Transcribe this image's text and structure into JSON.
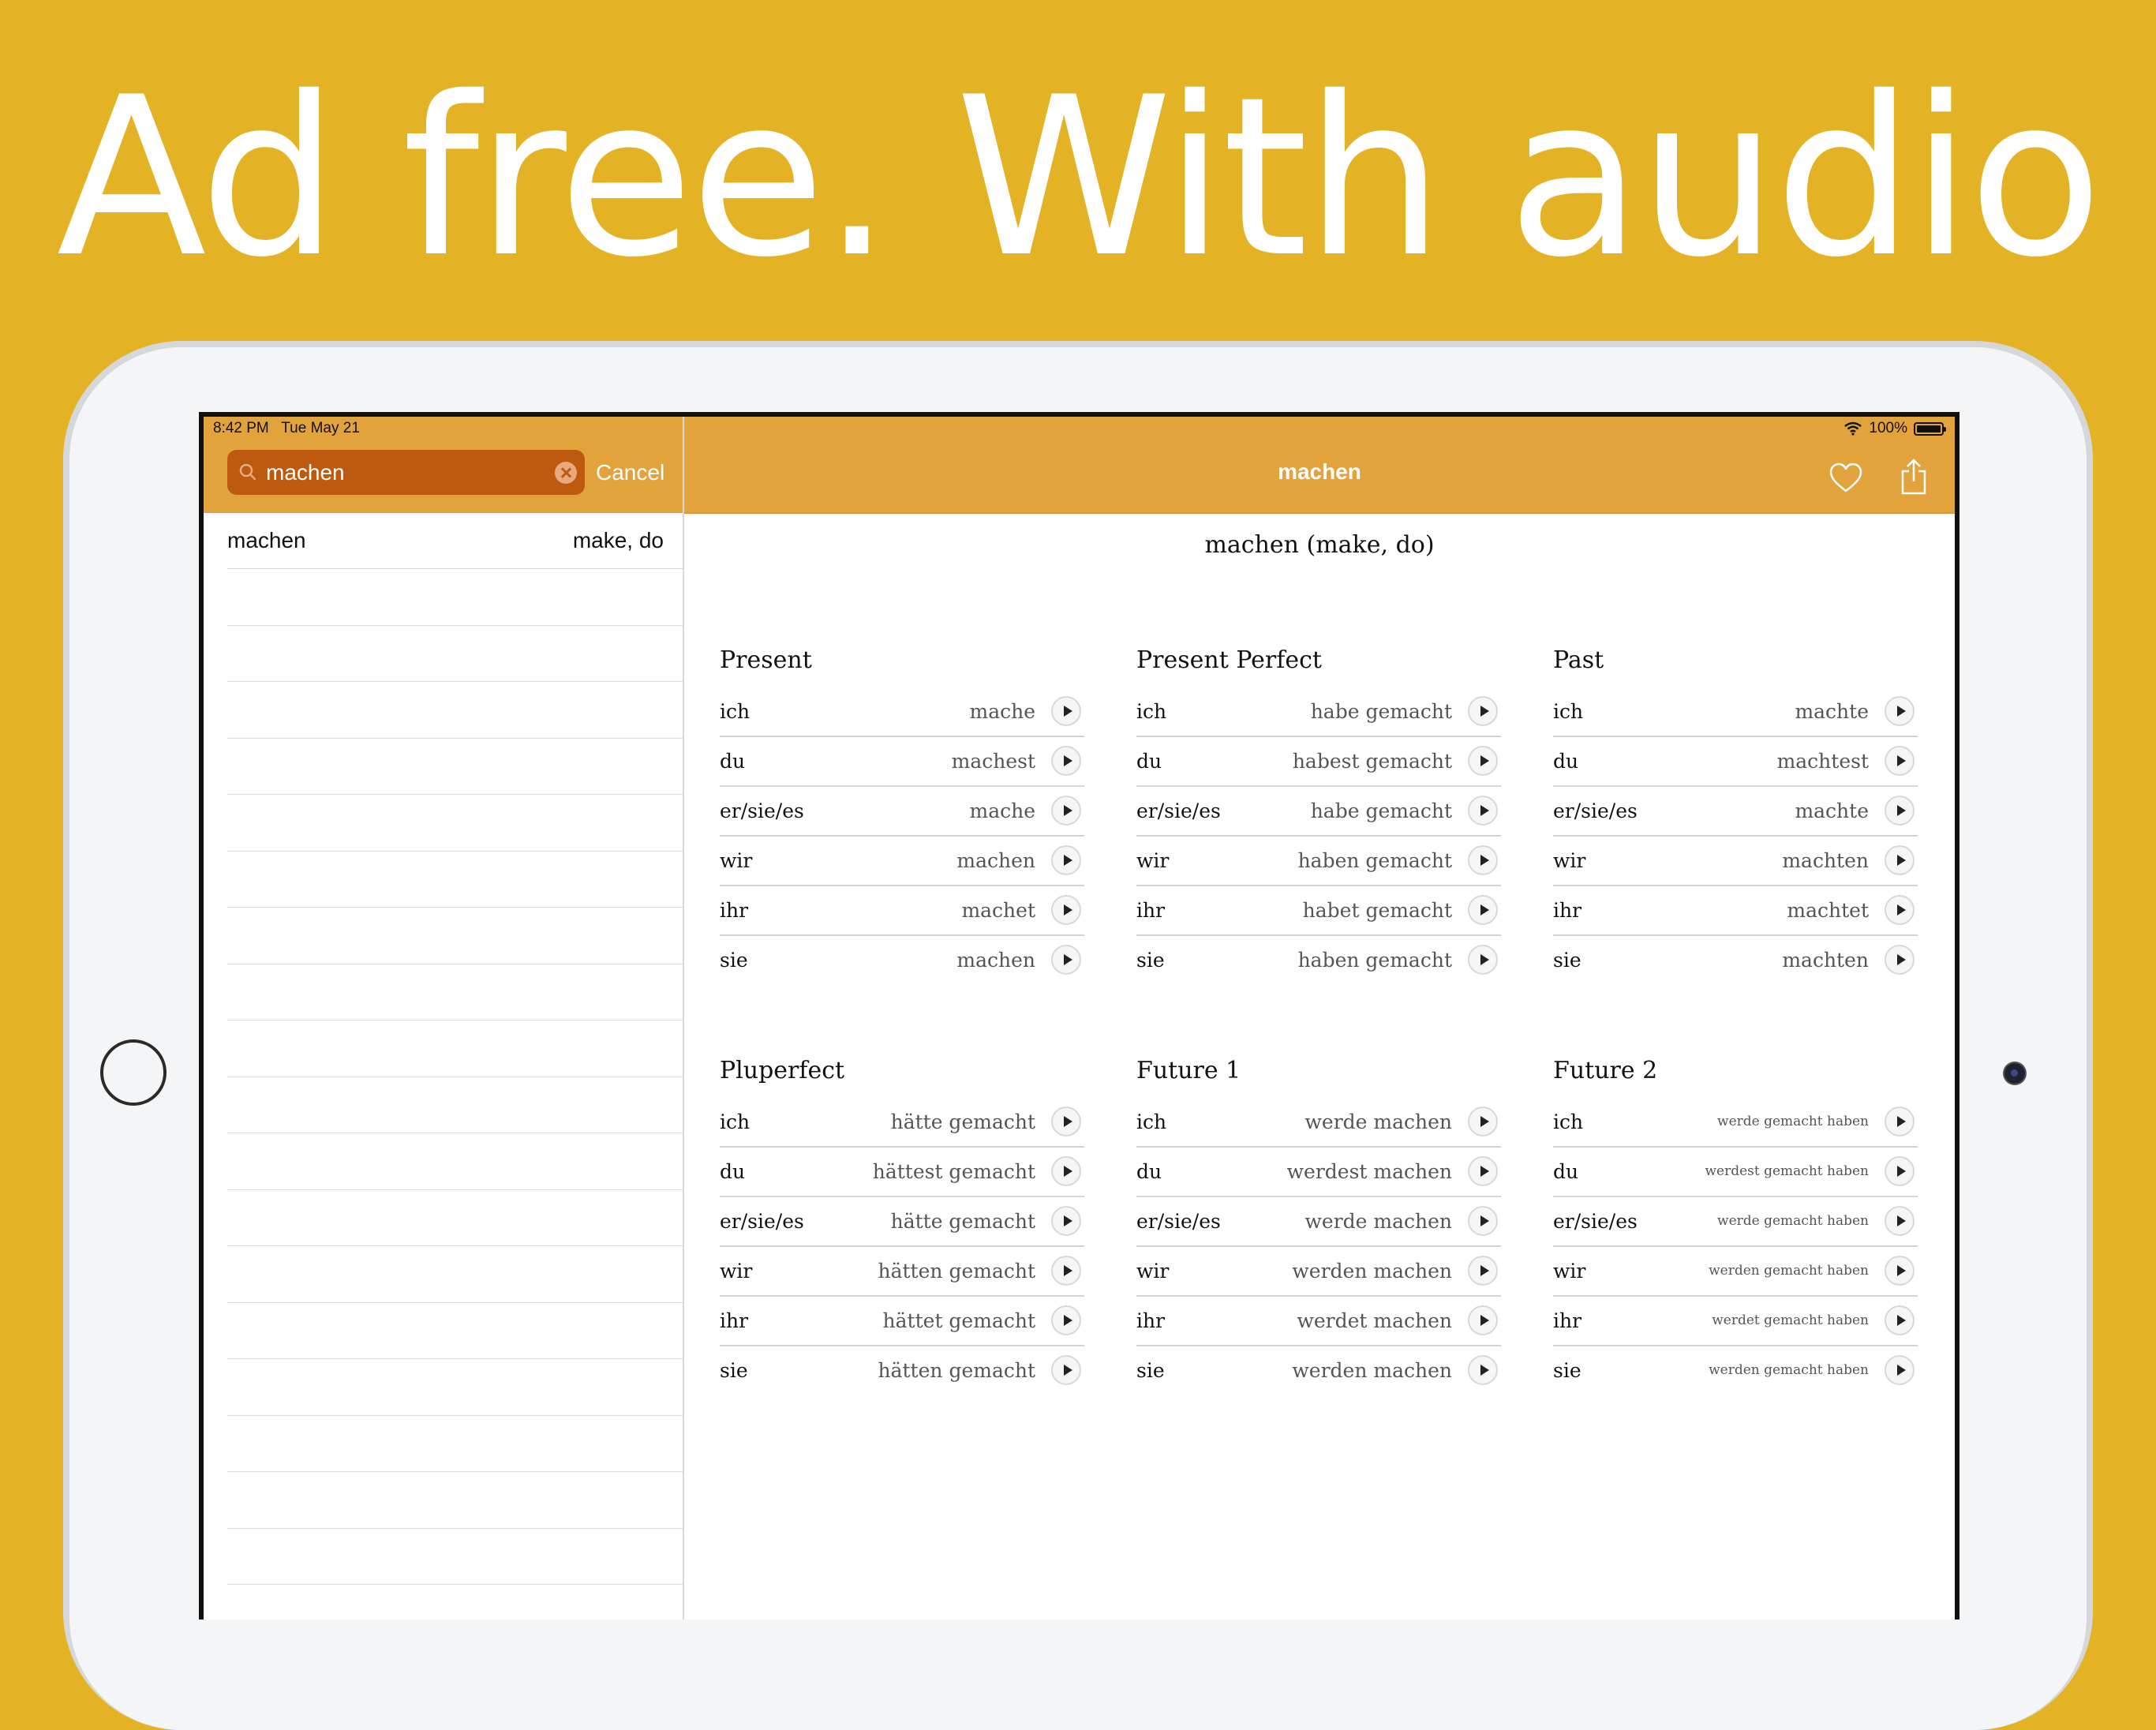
{
  "headline": "Ad free. With audio",
  "status": {
    "time": "8:42 PM",
    "date": "Tue May 21",
    "battery": "100%"
  },
  "search": {
    "value": "machen",
    "cancel_label": "Cancel"
  },
  "results": [
    {
      "word": "machen",
      "meaning": "make, do"
    }
  ],
  "nav": {
    "title": "machen"
  },
  "verb_heading": "machen (make, do)",
  "tenses": [
    {
      "name": "Present",
      "rows": [
        {
          "p": "ich",
          "f": "mache"
        },
        {
          "p": "du",
          "f": "machest"
        },
        {
          "p": "er/sie/es",
          "f": "mache"
        },
        {
          "p": "wir",
          "f": "machen"
        },
        {
          "p": "ihr",
          "f": "machet"
        },
        {
          "p": "sie",
          "f": "machen"
        }
      ]
    },
    {
      "name": "Present Perfect",
      "rows": [
        {
          "p": "ich",
          "f": "habe gemacht"
        },
        {
          "p": "du",
          "f": "habest gemacht"
        },
        {
          "p": "er/sie/es",
          "f": "habe gemacht"
        },
        {
          "p": "wir",
          "f": "haben gemacht"
        },
        {
          "p": "ihr",
          "f": "habet gemacht"
        },
        {
          "p": "sie",
          "f": "haben gemacht"
        }
      ]
    },
    {
      "name": "Past",
      "rows": [
        {
          "p": "ich",
          "f": "machte"
        },
        {
          "p": "du",
          "f": "machtest"
        },
        {
          "p": "er/sie/es",
          "f": "machte"
        },
        {
          "p": "wir",
          "f": "machten"
        },
        {
          "p": "ihr",
          "f": "machtet"
        },
        {
          "p": "sie",
          "f": "machten"
        }
      ]
    },
    {
      "name": "Pluperfect",
      "rows": [
        {
          "p": "ich",
          "f": "hätte gemacht"
        },
        {
          "p": "du",
          "f": "hättest gemacht"
        },
        {
          "p": "er/sie/es",
          "f": "hätte gemacht"
        },
        {
          "p": "wir",
          "f": "hätten gemacht"
        },
        {
          "p": "ihr",
          "f": "hättet gemacht"
        },
        {
          "p": "sie",
          "f": "hätten gemacht"
        }
      ]
    },
    {
      "name": "Future 1",
      "rows": [
        {
          "p": "ich",
          "f": "werde machen"
        },
        {
          "p": "du",
          "f": "werdest machen"
        },
        {
          "p": "er/sie/es",
          "f": "werde machen"
        },
        {
          "p": "wir",
          "f": "werden machen"
        },
        {
          "p": "ihr",
          "f": "werdet machen"
        },
        {
          "p": "sie",
          "f": "werden machen"
        }
      ]
    },
    {
      "name": "Future 2",
      "rows": [
        {
          "p": "ich",
          "f": "werde gemacht haben"
        },
        {
          "p": "du",
          "f": "werdest gemacht haben"
        },
        {
          "p": "er/sie/es",
          "f": "werde gemacht haben"
        },
        {
          "p": "wir",
          "f": "werden gemacht haben"
        },
        {
          "p": "ihr",
          "f": "werdet gemacht haben"
        },
        {
          "p": "sie",
          "f": "werden gemacht haben"
        }
      ]
    }
  ],
  "colors": {
    "background": "#E3B325",
    "nav_bar": "#E2A33D",
    "search_field": "#BD5A10"
  },
  "icons": {
    "search": "search-icon",
    "clear": "clear-icon",
    "heart": "heart-icon",
    "share": "share-icon",
    "play": "play-icon",
    "wifi": "wifi-icon",
    "battery": "battery-icon"
  }
}
